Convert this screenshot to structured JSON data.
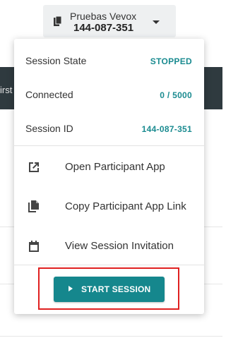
{
  "background": {
    "partial_text": "irst"
  },
  "session": {
    "name": "Pruebas Vevox",
    "code": "144-087-351"
  },
  "menu": {
    "stats": [
      {
        "label": "Session State",
        "value": "STOPPED"
      },
      {
        "label": "Connected",
        "value": "0 / 5000"
      },
      {
        "label": "Session ID",
        "value": "144-087-351"
      }
    ],
    "actions": [
      {
        "label": "Open Participant App",
        "icon": "external-link-icon"
      },
      {
        "label": "Copy Participant App Link",
        "icon": "copy-icon"
      },
      {
        "label": "View Session Invitation",
        "icon": "calendar-icon"
      }
    ],
    "start_label": "START SESSION"
  },
  "colors": {
    "accent": "#15878d",
    "value_text": "#1a8b90",
    "highlight": "#e02020",
    "dark_band": "#2f3a3f"
  }
}
